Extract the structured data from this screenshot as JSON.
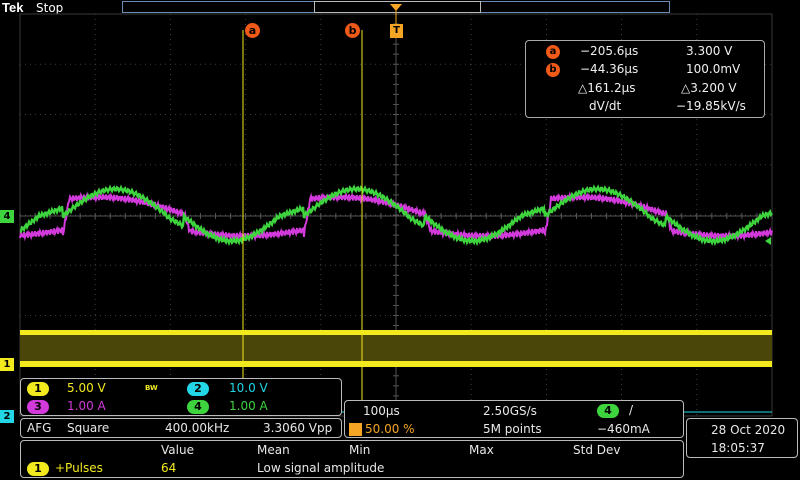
{
  "header": {
    "brand": "Tek",
    "run_state": "Stop"
  },
  "markers": {
    "a": "a",
    "b": "b",
    "trigger": "T"
  },
  "channel_markers": {
    "ch4": "4",
    "ch1": "1",
    "ch2": "2"
  },
  "cursor_readout": {
    "a_time": "−205.6µs",
    "a_value": "3.300 V",
    "b_time": "−44.36µs",
    "b_value": "100.0mV",
    "delta_time": "△161.2µs",
    "delta_value": "△3.200 V",
    "slope_label": "dV/dt",
    "slope_value": "−19.85kV/s"
  },
  "channels": [
    {
      "num": "1",
      "scale": "5.00 V",
      "bw": "BW",
      "color": "#f2ea1f"
    },
    {
      "num": "2",
      "scale": "10.0 V",
      "color": "#22d6e6"
    },
    {
      "num": "3",
      "scale": "1.00 A",
      "color": "#d23adb"
    },
    {
      "num": "4",
      "scale": "1.00 A",
      "color": "#3ed43e"
    }
  ],
  "afg": {
    "label": "AFG",
    "wave": "Square",
    "freq": "400.00kHz",
    "amp": "3.3060 Vpp"
  },
  "timebase": {
    "scale": "100µs",
    "sample_rate": "2.50GS/s",
    "trig_pos": "50.00 %",
    "record": "5M points",
    "trig_source": "4",
    "trig_slope": "/",
    "trig_level": "−460mA"
  },
  "datetime": {
    "date": "28 Oct  2020",
    "time": "18:05:37"
  },
  "measurements": {
    "headers": [
      "Value",
      "Mean",
      "Min",
      "Max",
      "Std Dev"
    ],
    "row": {
      "channel": "1",
      "name": "+Pulses",
      "value": "64",
      "note": "Low signal amplitude"
    }
  },
  "colors": {
    "ch1": "#f2ea1f",
    "ch2": "#22d6e6",
    "ch3": "#d23adb",
    "ch4": "#3ed43e",
    "cursor": "#f05a18",
    "trigger": "#f5a524"
  }
}
